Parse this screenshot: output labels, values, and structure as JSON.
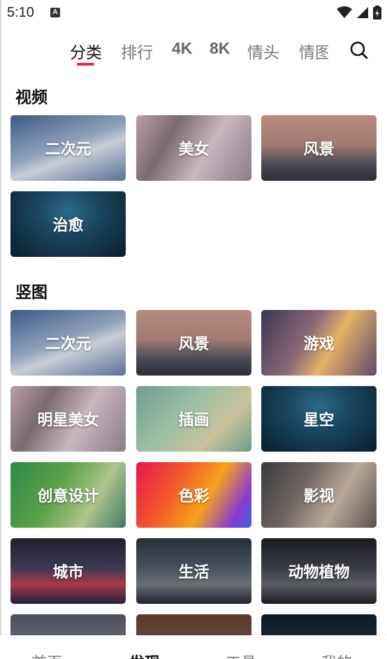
{
  "status_bar": {
    "time": "5:10",
    "notification_icon": "A"
  },
  "top_tabs": {
    "items": [
      {
        "label": "分类",
        "active": true
      },
      {
        "label": "排行",
        "active": false
      },
      {
        "label": "4K",
        "active": false
      },
      {
        "label": "8K",
        "active": false
      },
      {
        "label": "情头",
        "active": false
      },
      {
        "label": "情图",
        "active": false
      }
    ],
    "accent_color": "#e8294a"
  },
  "sections": [
    {
      "title": "视频",
      "cards": [
        {
          "label": "二次元",
          "bg": "linear-gradient(160deg,#3c5a86 0%,#8ea0b8 45%,#c7ccd6 60%,#5a7196 100%)"
        },
        {
          "label": "美女",
          "bg": "linear-gradient(120deg,#b9a0a4 0%,#7a6a72 30%,#c9b7bf 60%,#8b7c89 100%)"
        },
        {
          "label": "风景",
          "bg": "linear-gradient(180deg,#b58a7c 0%,#9f7b73 45%,#4a4a55 75%,#2e2e38 100%)"
        },
        {
          "label": "治愈",
          "bg": "radial-gradient(ellipse at 50% 30%,#2b6a85 0%,#17425a 45%,#0b1d2a 100%)"
        }
      ]
    },
    {
      "title": "竖图",
      "cards": [
        {
          "label": "二次元",
          "bg": "linear-gradient(160deg,#3c5a86 0%,#8ea0b8 45%,#c7ccd6 60%,#5a7196 100%)"
        },
        {
          "label": "风景",
          "bg": "linear-gradient(180deg,#b58a7c 0%,#9f7b73 45%,#4a4a55 75%,#2e2e38 100%)"
        },
        {
          "label": "游戏",
          "bg": "linear-gradient(120deg,#3a3552 0%,#8c6a78 40%,#e6b266 60%,#5c4a6a 100%)"
        },
        {
          "label": "明星美女",
          "bg": "linear-gradient(120deg,#b9a0a4 0%,#7a6a72 30%,#c9b7bf 60%,#8b7c89 100%)"
        },
        {
          "label": "插画",
          "bg": "linear-gradient(135deg,#6f9c8f 0%,#9bbfa6 40%,#c9c29a 70%,#6f9c8f 100%)"
        },
        {
          "label": "星空",
          "bg": "radial-gradient(ellipse at 50% 30%,#2b6a85 0%,#17425a 45%,#0b1d2a 100%)"
        },
        {
          "label": "创意设计",
          "bg": "linear-gradient(120deg,#2f8a4a 0%,#5aa247 40%,#b0c48a 70%,#3f7a68 100%)"
        },
        {
          "label": "色彩",
          "bg": "linear-gradient(120deg,#e8174f 0%,#f25c2a 35%,#f6a31c 60%,#8a3ad0 85%,#3a66e0 100%)"
        },
        {
          "label": "影视",
          "bg": "linear-gradient(120deg,#3a3a3e 0%,#6e6460 35%,#b8a89a 65%,#5a5150 100%)"
        },
        {
          "label": "城市",
          "bg": "linear-gradient(180deg,#1d1f2b 0%,#3d3a54 45%,#a8394a 70%,#20223a 100%)"
        },
        {
          "label": "生活",
          "bg": "linear-gradient(180deg,#28303a 0%,#46525e 45%,#6a6f74 70%,#202630 100%)"
        },
        {
          "label": "动物植物",
          "bg": "linear-gradient(180deg,#1a1c22 0%,#3a3c44 45%,#5a5c64 70%,#1a1c22 100%)"
        },
        {
          "label": "",
          "bg": "linear-gradient(180deg,#4a4e5a 0%,#8a8c92 100%)"
        },
        {
          "label": "",
          "bg": "linear-gradient(180deg,#5a3a2a 0%,#6a6060 100%)"
        },
        {
          "label": "",
          "bg": "linear-gradient(180deg,#0f1a24 0%,#2a3a4a 100%)"
        }
      ]
    }
  ],
  "bottom_nav": {
    "items": [
      {
        "label": "首页",
        "active": false
      },
      {
        "label": "发现",
        "active": true
      },
      {
        "label": "工具",
        "active": false
      },
      {
        "label": "我的",
        "active": false
      }
    ]
  }
}
